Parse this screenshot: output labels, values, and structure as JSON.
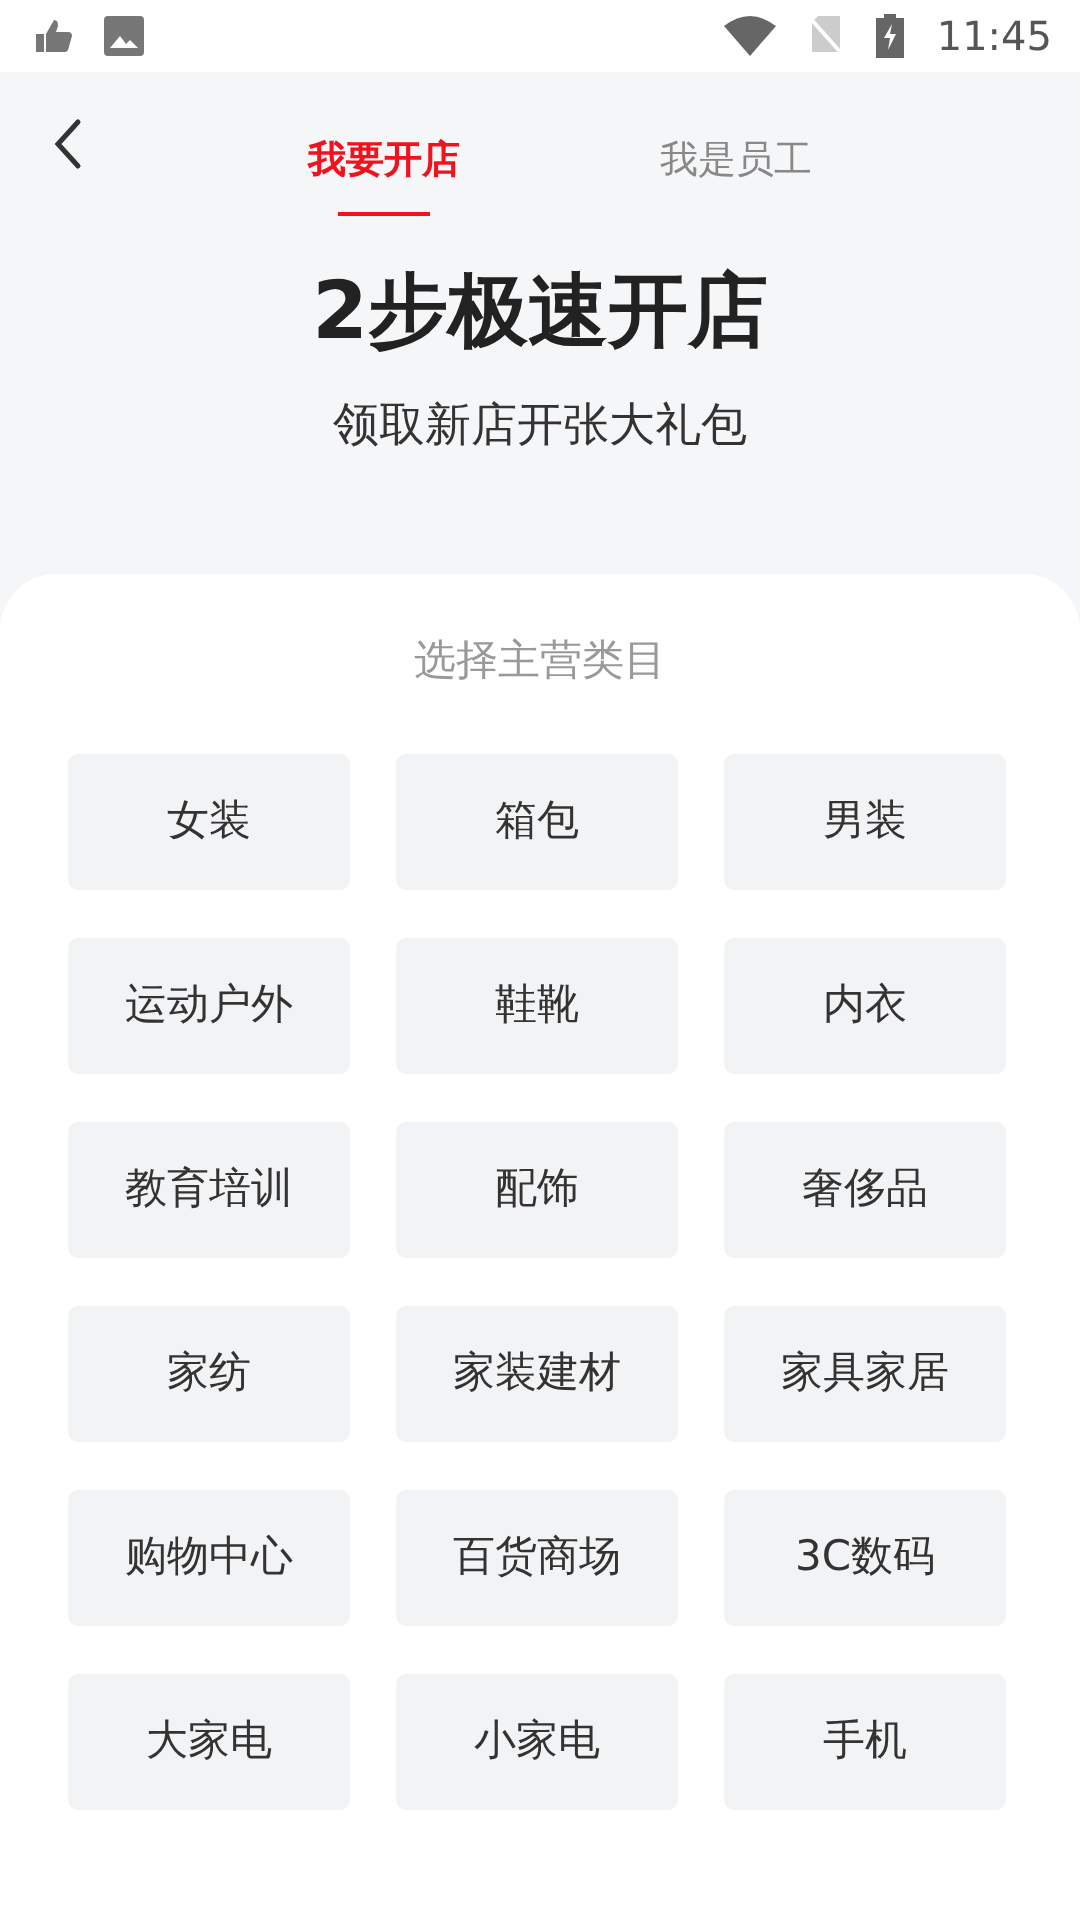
{
  "status_bar": {
    "time": "11:45"
  },
  "tabs": [
    {
      "label": "我要开店",
      "selected": true
    },
    {
      "label": "我是员工",
      "selected": false
    }
  ],
  "hero": {
    "title": "2步极速开店",
    "subtitle": "领取新店开张大礼包"
  },
  "section": {
    "title": "选择主营类目"
  },
  "categories": [
    "女装",
    "箱包",
    "男装",
    "运动户外",
    "鞋靴",
    "内衣",
    "教育培训",
    "配饰",
    "奢侈品",
    "家纺",
    "家装建材",
    "家具家居",
    "购物中心",
    "百货商场",
    "3C数码",
    "大家电",
    "小家电",
    "手机"
  ]
}
